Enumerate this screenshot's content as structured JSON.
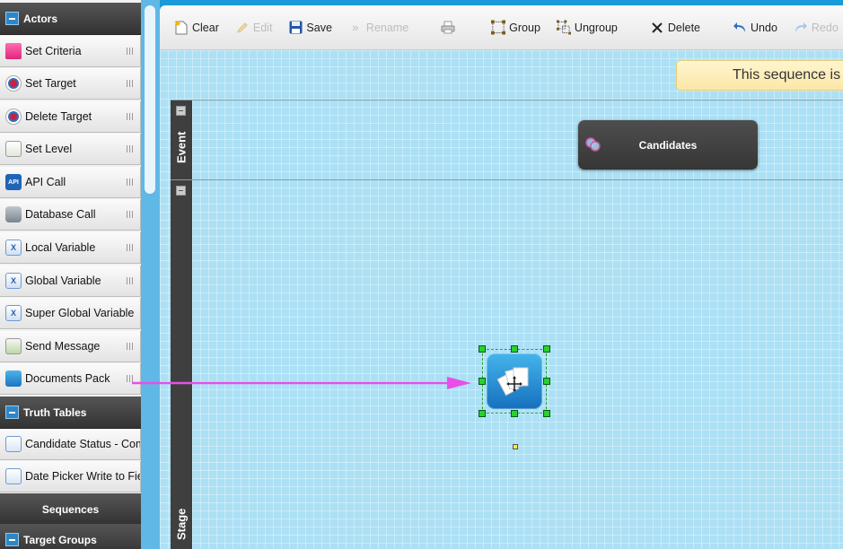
{
  "sidebar": {
    "actors_header": "Actors",
    "actors": [
      {
        "label": "Set Criteria",
        "icon": "folder-icon"
      },
      {
        "label": "Set Target",
        "icon": "target-icon"
      },
      {
        "label": "Delete Target",
        "icon": "target-icon"
      },
      {
        "label": "Set Level",
        "icon": "level-icon"
      },
      {
        "label": "API Call",
        "icon": "api-icon",
        "badge": "API"
      },
      {
        "label": "Database Call",
        "icon": "database-icon"
      },
      {
        "label": "Local Variable",
        "icon": "variable-icon",
        "badge": "X"
      },
      {
        "label": "Global Variable",
        "icon": "variable-icon",
        "badge": "X"
      },
      {
        "label": "Super Global Variable",
        "icon": "variable-icon",
        "badge": "X"
      },
      {
        "label": "Send Message",
        "icon": "message-icon"
      },
      {
        "label": "Documents Pack",
        "icon": "documents-icon"
      }
    ],
    "truth_tables_header": "Truth Tables",
    "truth_tables": [
      {
        "label": "Candidate Status - Complete"
      },
      {
        "label": "Date Picker Write to Field"
      }
    ],
    "sequences_header": "Sequences",
    "target_groups_header": "Target Groups"
  },
  "toolbar": {
    "clear": "Clear",
    "edit": "Edit",
    "save": "Save",
    "rename": "Rename",
    "group": "Group",
    "ungroup": "Ungroup",
    "delete": "Delete",
    "undo": "Undo",
    "redo": "Redo"
  },
  "canvas": {
    "banner": "This sequence is",
    "event_lane_label": "Event",
    "stage_lane_label": "Stage",
    "event_node_label": "Candidates"
  },
  "colors": {
    "accent": "#2f86c6",
    "canvas_bg": "#ace0f5",
    "drag_arrow": "#e84ee8",
    "selection_handle": "#27d12f"
  }
}
